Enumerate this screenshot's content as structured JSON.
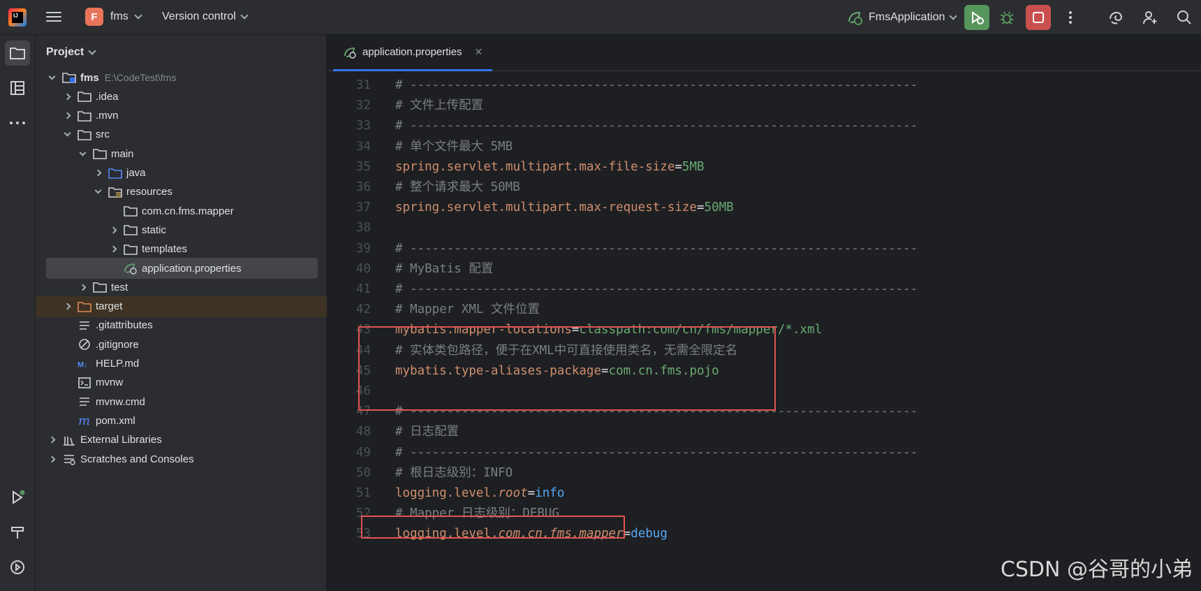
{
  "titlebar": {
    "logo": "IJ",
    "project_badge": "F",
    "project_name": "fms",
    "version_control": "Version control",
    "run_config": "FmsApplication"
  },
  "project_panel": {
    "title": "Project",
    "tree": [
      {
        "label": "fms",
        "path": "E:\\CodeTest\\fms",
        "icon": "module-folder-icon",
        "depth": 0,
        "expanded": true
      },
      {
        "label": ".idea",
        "icon": "folder-icon",
        "depth": 1,
        "expanded": false
      },
      {
        "label": ".mvn",
        "icon": "folder-icon",
        "depth": 1,
        "expanded": false
      },
      {
        "label": "src",
        "icon": "folder-icon",
        "depth": 1,
        "expanded": true
      },
      {
        "label": "main",
        "icon": "folder-icon",
        "depth": 2,
        "expanded": true
      },
      {
        "label": "java",
        "icon": "source-folder-icon",
        "depth": 3,
        "expanded": false
      },
      {
        "label": "resources",
        "icon": "resources-folder-icon",
        "depth": 3,
        "expanded": true
      },
      {
        "label": "com.cn.fms.mapper",
        "icon": "folder-icon",
        "depth": 4,
        "leaf": true
      },
      {
        "label": "static",
        "icon": "folder-icon",
        "depth": 4,
        "expanded": false
      },
      {
        "label": "templates",
        "icon": "folder-icon",
        "depth": 4,
        "expanded": false
      },
      {
        "label": "application.properties",
        "icon": "spring-properties-icon",
        "depth": 4,
        "leaf": true,
        "selected": true
      },
      {
        "label": "test",
        "icon": "folder-icon",
        "depth": 2,
        "expanded": false
      },
      {
        "label": "target",
        "icon": "excluded-folder-icon",
        "depth": 1,
        "expanded": false,
        "excluded": true
      },
      {
        "label": ".gitattributes",
        "icon": "text-file-icon",
        "depth": 1,
        "leaf": true
      },
      {
        "label": ".gitignore",
        "icon": "ignore-file-icon",
        "depth": 1,
        "leaf": true
      },
      {
        "label": "HELP.md",
        "icon": "markdown-icon",
        "depth": 1,
        "leaf": true
      },
      {
        "label": "mvnw",
        "icon": "shell-script-icon",
        "depth": 1,
        "leaf": true
      },
      {
        "label": "mvnw.cmd",
        "icon": "text-file-icon",
        "depth": 1,
        "leaf": true
      },
      {
        "label": "pom.xml",
        "icon": "maven-icon",
        "depth": 1,
        "leaf": true
      },
      {
        "label": "External Libraries",
        "icon": "libraries-icon",
        "depth": 0,
        "expanded": false
      },
      {
        "label": "Scratches and Consoles",
        "icon": "scratches-icon",
        "depth": 0,
        "expanded": false
      }
    ]
  },
  "editor": {
    "tab_label": "application.properties",
    "lines": [
      {
        "n": "31",
        "parts": [
          [
            "c",
            "# ---------------------------------------------------------------------"
          ]
        ]
      },
      {
        "n": "32",
        "parts": [
          [
            "c",
            "# 文件上传配置"
          ]
        ]
      },
      {
        "n": "33",
        "parts": [
          [
            "c",
            "# ---------------------------------------------------------------------"
          ]
        ]
      },
      {
        "n": "34",
        "parts": [
          [
            "c",
            "# 单个文件最大 5MB"
          ]
        ]
      },
      {
        "n": "35",
        "parts": [
          [
            "k",
            "spring.servlet.multipart.max-file-size"
          ],
          [
            "t",
            "="
          ],
          [
            "v",
            "5MB"
          ]
        ]
      },
      {
        "n": "36",
        "parts": [
          [
            "c",
            "# 整个请求最大 50MB"
          ]
        ]
      },
      {
        "n": "37",
        "parts": [
          [
            "k",
            "spring.servlet.multipart.max-request-size"
          ],
          [
            "t",
            "="
          ],
          [
            "v",
            "50MB"
          ]
        ]
      },
      {
        "n": "38",
        "parts": []
      },
      {
        "n": "39",
        "parts": [
          [
            "c",
            "# ---------------------------------------------------------------------"
          ]
        ]
      },
      {
        "n": "40",
        "parts": [
          [
            "c",
            "# MyBatis 配置"
          ]
        ]
      },
      {
        "n": "41",
        "parts": [
          [
            "c",
            "# ---------------------------------------------------------------------"
          ]
        ]
      },
      {
        "n": "42",
        "parts": [
          [
            "c",
            "# Mapper XML 文件位置"
          ]
        ]
      },
      {
        "n": "43",
        "parts": [
          [
            "k",
            "mybatis.mapper-locations"
          ],
          [
            "t",
            "="
          ],
          [
            "v",
            "classpath:com/cn/fms/mapper/*.xml"
          ]
        ]
      },
      {
        "n": "44",
        "parts": [
          [
            "c",
            "# 实体类包路径，便于在XML中可直接使用类名，无需全限定名"
          ]
        ]
      },
      {
        "n": "45",
        "parts": [
          [
            "k",
            "mybatis.type-aliases-package"
          ],
          [
            "t",
            "="
          ],
          [
            "v",
            "com.cn.fms.pojo"
          ]
        ]
      },
      {
        "n": "46",
        "parts": []
      },
      {
        "n": "47",
        "parts": [
          [
            "c",
            "# ---------------------------------------------------------------------"
          ]
        ]
      },
      {
        "n": "48",
        "parts": [
          [
            "c",
            "# 日志配置"
          ]
        ]
      },
      {
        "n": "49",
        "parts": [
          [
            "c",
            "# ---------------------------------------------------------------------"
          ]
        ]
      },
      {
        "n": "50",
        "parts": [
          [
            "c",
            "# 根日志级别：INFO"
          ]
        ]
      },
      {
        "n": "51",
        "parts": [
          [
            "k",
            "logging.level."
          ],
          [
            "ki",
            "root"
          ],
          [
            "t",
            "="
          ],
          [
            "b",
            "info"
          ]
        ]
      },
      {
        "n": "52",
        "parts": [
          [
            "c",
            "# Mapper 日志级别：DEBUG"
          ]
        ]
      },
      {
        "n": "53",
        "parts": [
          [
            "k",
            "logging.level."
          ],
          [
            "ki",
            "com.cn.fms.mapper"
          ],
          [
            "t",
            "="
          ],
          [
            "b",
            "debug"
          ]
        ]
      }
    ]
  },
  "watermark": "CSDN @谷哥的小弟"
}
